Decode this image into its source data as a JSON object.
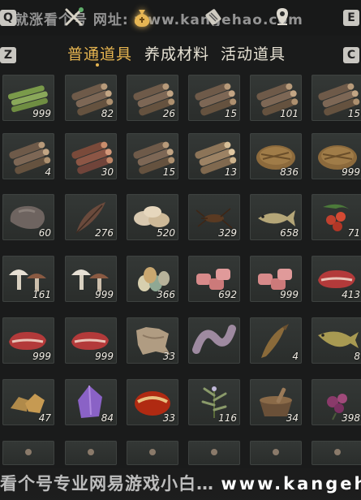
{
  "top_watermark": "戏就涨看个号 网址: www.kangehao.com",
  "bottom_watermark_cn": "看个号专业网易游戏小白…",
  "bottom_watermark_url": "www.kangehao.com",
  "keys": {
    "left_top": "Q",
    "right_top": "E",
    "left_tab": "Z",
    "right_tab": "C"
  },
  "nav_icons": [
    "crossed-tools-icon",
    "money-bag-icon",
    "scroll-icon",
    "map-pin-icon"
  ],
  "tabs": [
    {
      "label": "普通道具",
      "active": true
    },
    {
      "label": "养成材料",
      "active": false
    },
    {
      "label": "活动道具",
      "active": false
    }
  ],
  "colors": {
    "accent": "#e5b450",
    "slot": "#303331",
    "background": "#1a1b1b"
  },
  "items": [
    {
      "icon": "bamboo-logs",
      "count": "999"
    },
    {
      "icon": "wood-logs",
      "count": "82"
    },
    {
      "icon": "wood-logs",
      "count": "26"
    },
    {
      "icon": "wood-logs",
      "count": "15"
    },
    {
      "icon": "wood-logs",
      "count": "101"
    },
    {
      "icon": "wood-logs",
      "count": "15"
    },
    {
      "icon": "wood-logs",
      "count": "4"
    },
    {
      "icon": "wood-logs-red",
      "count": "30"
    },
    {
      "icon": "wood-logs",
      "count": "15"
    },
    {
      "icon": "wood-logs-light",
      "count": "13"
    },
    {
      "icon": "straw-bundle",
      "count": "836"
    },
    {
      "icon": "straw-bundle",
      "count": "999"
    },
    {
      "icon": "stone",
      "count": "60"
    },
    {
      "icon": "feather",
      "count": "276"
    },
    {
      "icon": "shells",
      "count": "520"
    },
    {
      "icon": "insect",
      "count": "329"
    },
    {
      "icon": "fish",
      "count": "658"
    },
    {
      "icon": "berries",
      "count": "71"
    },
    {
      "icon": "mushrooms",
      "count": "161"
    },
    {
      "icon": "mushrooms",
      "count": "999"
    },
    {
      "icon": "eggs",
      "count": "366"
    },
    {
      "icon": "meat-chunks",
      "count": "692"
    },
    {
      "icon": "meat-chunks",
      "count": "999"
    },
    {
      "icon": "steak",
      "count": "413"
    },
    {
      "icon": "steak",
      "count": "999"
    },
    {
      "icon": "steak",
      "count": "999"
    },
    {
      "icon": "hide",
      "count": "33"
    },
    {
      "icon": "snake-meat",
      "count": ""
    },
    {
      "icon": "eel",
      "count": "4"
    },
    {
      "icon": "carp",
      "count": "8"
    },
    {
      "icon": "ore-chunks",
      "count": "47"
    },
    {
      "icon": "amethyst",
      "count": "84"
    },
    {
      "icon": "red-gem",
      "count": "33"
    },
    {
      "icon": "herb",
      "count": "116"
    },
    {
      "icon": "mortar",
      "count": "34"
    },
    {
      "icon": "purple-flower",
      "count": "398"
    },
    {
      "icon": "partial-item",
      "count": ""
    },
    {
      "icon": "partial-item",
      "count": ""
    },
    {
      "icon": "partial-item",
      "count": ""
    },
    {
      "icon": "partial-item",
      "count": ""
    },
    {
      "icon": "partial-item",
      "count": ""
    },
    {
      "icon": "partial-item",
      "count": ""
    }
  ]
}
